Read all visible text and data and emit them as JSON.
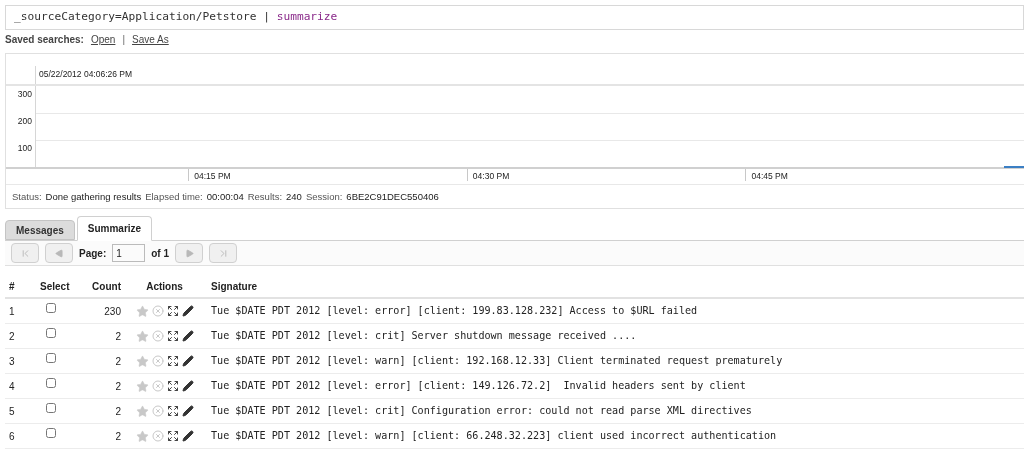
{
  "search": {
    "query": "_sourceCategory=Application/Petstore | ",
    "operator": "summarize"
  },
  "saved_searches": {
    "label": "Saved searches:",
    "links": [
      "Open",
      "Save As"
    ],
    "separator": "|"
  },
  "timeline": {
    "timestamp": "05/22/2012 04:06:26 PM",
    "y_labels": [
      "300",
      "200",
      "100"
    ],
    "x_labels": [
      "04:15 PM",
      "04:30 PM",
      "04:45 PM"
    ]
  },
  "status_bar": [
    {
      "label": "Status:",
      "value": "Done gathering results"
    },
    {
      "label": "Elapsed time:",
      "value": "00:00:04"
    },
    {
      "label": "Results:",
      "value": "240"
    },
    {
      "label": "Session:",
      "value": "6BE2C91DEC550406"
    }
  ],
  "tabs": [
    {
      "label": "Messages",
      "selected": false
    },
    {
      "label": "Summarize",
      "selected": true
    }
  ],
  "pager": {
    "label": "Page:",
    "value": "1",
    "of": "of 1"
  },
  "table": {
    "columns": [
      "#",
      "Select",
      "Count",
      "Actions",
      "Signature"
    ],
    "rows": [
      {
        "index": "1",
        "checked": false,
        "count": "230",
        "signature": "Tue $DATE PDT 2012 [level: error] [client: 199.83.128.232] Access to $URL failed"
      },
      {
        "index": "2",
        "checked": false,
        "count": "2",
        "signature": "Tue $DATE PDT 2012 [level: crit] Server shutdown message received ...."
      },
      {
        "index": "3",
        "checked": false,
        "count": "2",
        "signature": "Tue $DATE PDT 2012 [level: warn] [client: 192.168.12.33] Client terminated request prematurely"
      },
      {
        "index": "4",
        "checked": false,
        "count": "2",
        "signature": "Tue $DATE PDT 2012 [level: error] [client: 149.126.72.2]  Invalid headers sent by client"
      },
      {
        "index": "5",
        "checked": false,
        "count": "2",
        "signature": "Tue $DATE PDT 2012 [level: crit] Configuration error: could not read parse XML directives"
      },
      {
        "index": "6",
        "checked": false,
        "count": "2",
        "signature": "Tue $DATE PDT 2012 [level: warn] [client: 66.248.32.223] client used incorrect authentication"
      }
    ]
  }
}
